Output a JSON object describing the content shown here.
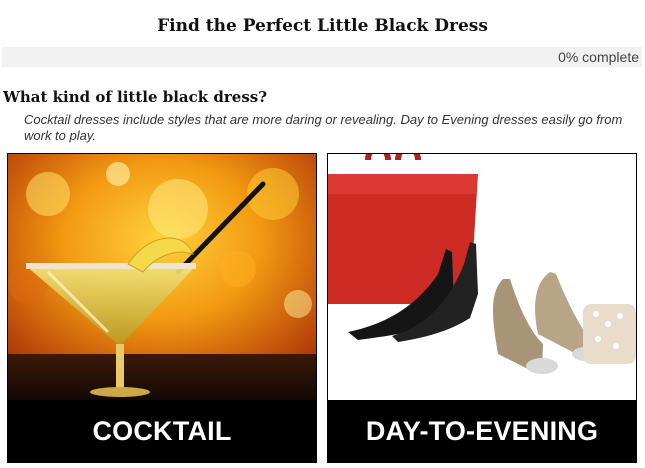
{
  "header": {
    "title": "Find the Perfect Little Black Dress"
  },
  "progress": {
    "text": "0% complete",
    "value_percent": 0
  },
  "question": {
    "title": "What kind of little black dress?",
    "description": "Cocktail dresses include styles that are more daring or revealing. Day to Evening dresses easily go from work to play."
  },
  "options": [
    {
      "label": "COCKTAIL",
      "image_icon": "cocktail-martini-image"
    },
    {
      "label": "DAY-TO-EVENING",
      "image_icon": "handbag-and-heels-image"
    }
  ],
  "colors": {
    "label_bg": "#000000",
    "label_text": "#ffffff",
    "progress_track": "#f1f1f1"
  }
}
